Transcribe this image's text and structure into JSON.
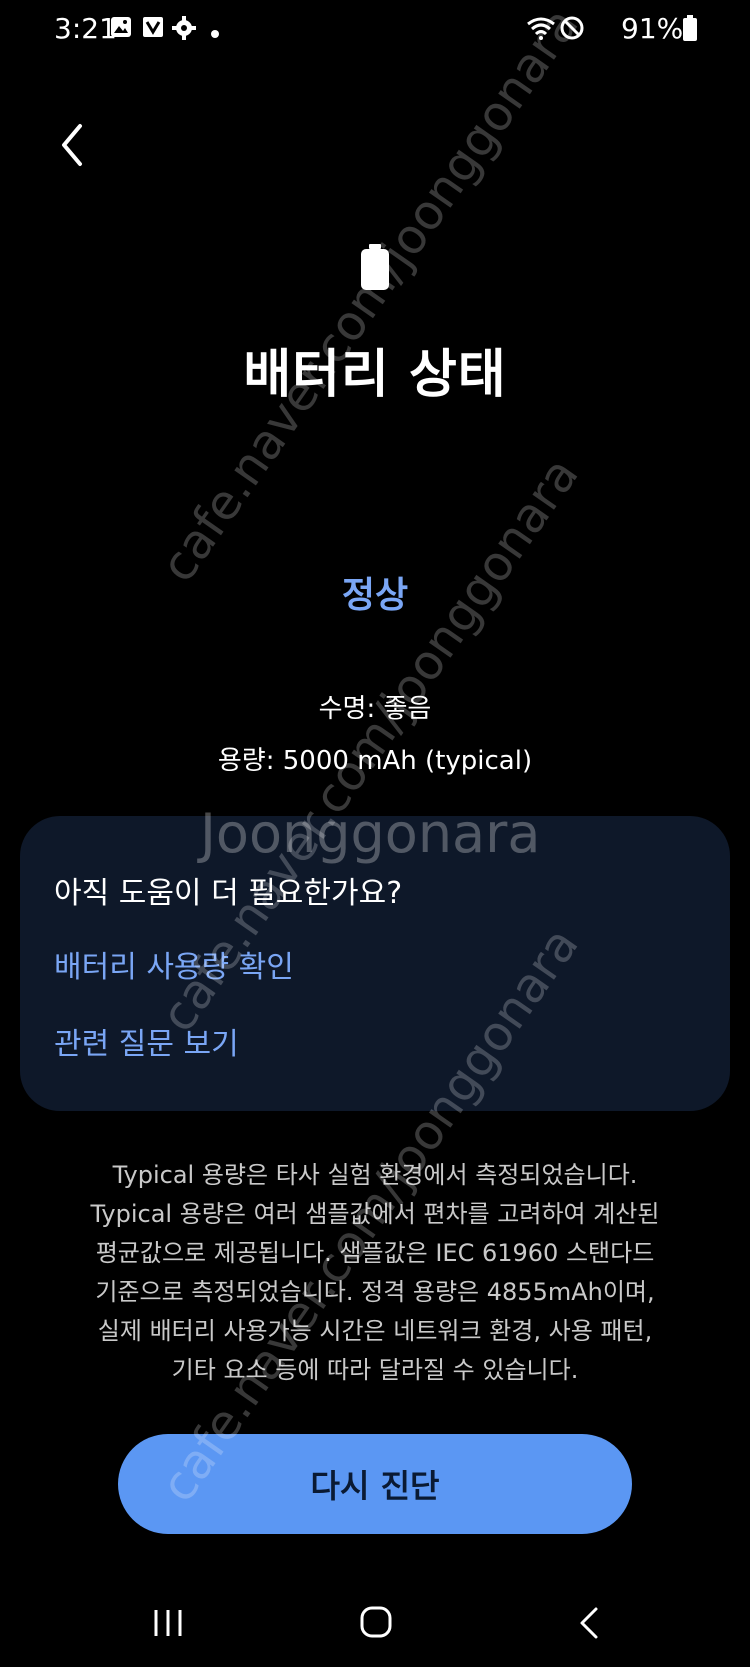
{
  "status_bar": {
    "time": "3:21",
    "battery_percent": "91%"
  },
  "page": {
    "title": "배터리 상태",
    "status": "정상",
    "life_label": "수명: 좋음",
    "capacity_label": "용량: 5000 mAh (typical)"
  },
  "help_card": {
    "title": "아직 도움이 더 필요한가요?",
    "links": [
      {
        "label": "배터리 사용량 확인"
      },
      {
        "label": "관련 질문 보기"
      }
    ]
  },
  "disclaimer": [
    "Typical 용량은 타사 실험 환경에서 측정되었습니다.",
    "Typical 용량은 여러 샘플값에서 편차를 고려하여 계산된",
    "평균값으로 제공됩니다. 샘플값은 IEC 61960 스탠다드",
    "기준으로 측정되었습니다. 정격 용량은 4855mAh이며,",
    "실제 배터리 사용가능 시간은 네트워크 환경, 사용 패턴,",
    "기타 요소 등에 따라 달라질 수 있습니다."
  ],
  "action_button": {
    "label": "다시 진단"
  },
  "watermark": {
    "url_text": "cafe.naver.com/joonggonara",
    "logo_text": "Joonggonara"
  },
  "colors": {
    "accent": "#7aa6f5",
    "button": "#5b97f3",
    "card": "#0e1829"
  },
  "icons": [
    "back-icon",
    "battery-icon",
    "recents-icon",
    "home-icon",
    "nav-back-icon"
  ]
}
